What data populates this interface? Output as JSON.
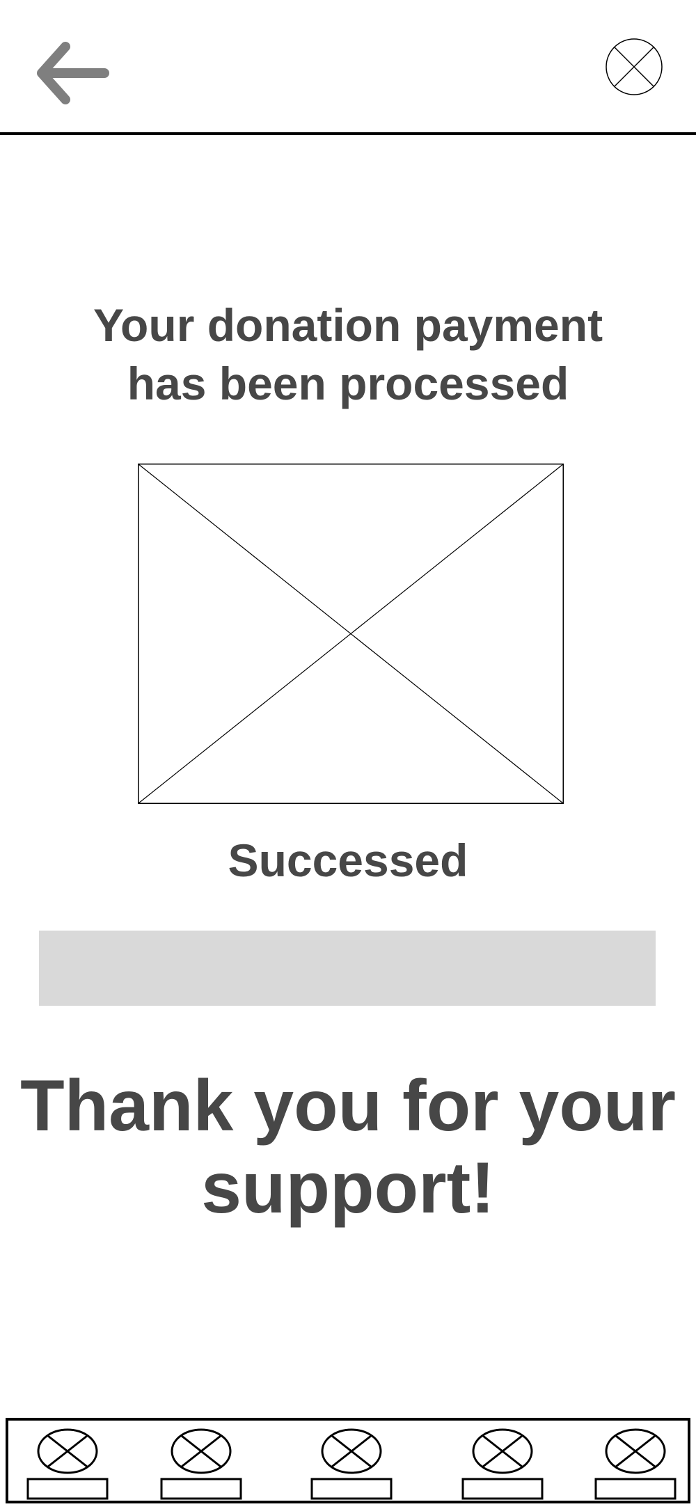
{
  "header": {
    "back_icon": "arrow-left-icon",
    "close_icon": "close-circle-icon"
  },
  "main": {
    "headline_line1": "Your donation payment",
    "headline_line2": "has been processed",
    "image_icon": "image-placeholder-icon",
    "status": "Successed",
    "thanks_line1": "Thank you for your",
    "thanks_line2": "support!"
  },
  "colors": {
    "text": "#474747",
    "icon_gray": "#7f7f7f",
    "bar_gray": "#d9d9d9",
    "border": "#000000"
  },
  "bottom_nav": {
    "items": [
      {
        "icon": "placeholder-icon"
      },
      {
        "icon": "placeholder-icon"
      },
      {
        "icon": "placeholder-icon"
      },
      {
        "icon": "placeholder-icon"
      },
      {
        "icon": "placeholder-icon"
      }
    ]
  }
}
